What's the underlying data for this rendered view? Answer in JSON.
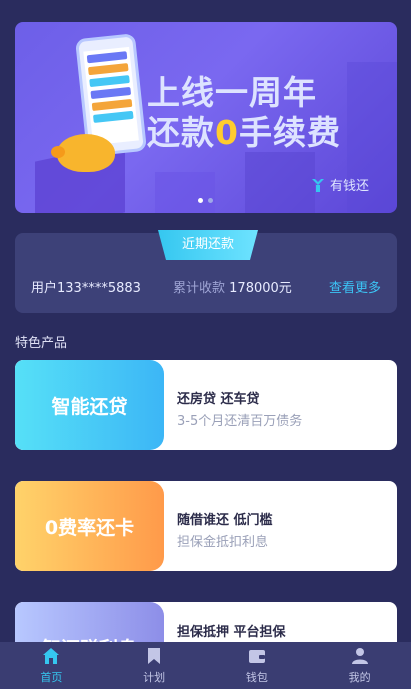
{
  "banner": {
    "line1": "上线一周年",
    "line2_a": "还款",
    "line2_b": "0",
    "line2_c": "手续费",
    "brand": "有钱还"
  },
  "recent": {
    "tab": "近期还款",
    "user": "用户133****5883",
    "total_label": "累计收款",
    "total_value": "178000元",
    "more": "查看更多"
  },
  "section_title": "特色产品",
  "products": [
    {
      "name": "智能还贷",
      "line1": "还房贷 还车贷",
      "line2": "3-5个月还清百万债务"
    },
    {
      "name": "0费率还卡",
      "line1": "随借谁还 低门槛",
      "line2": "担保金抵扣利息"
    },
    {
      "name": "智还赚利息",
      "line1": "担保抵押 平台担保",
      "line2": ""
    }
  ],
  "tabbar": [
    {
      "label": "首页",
      "icon": "home-icon",
      "active": true
    },
    {
      "label": "计划",
      "icon": "bookmark-icon",
      "active": false
    },
    {
      "label": "钱包",
      "icon": "wallet-icon",
      "active": false
    },
    {
      "label": "我的",
      "icon": "user-icon",
      "active": false
    }
  ],
  "colors": {
    "background": "#2a2c5e",
    "accent": "#35c7f0",
    "highlight": "#ffcc2e"
  }
}
